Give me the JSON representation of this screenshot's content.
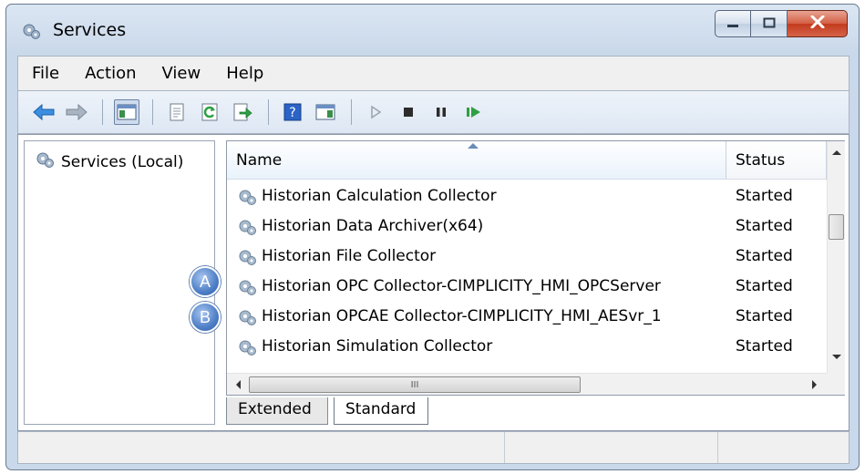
{
  "window": {
    "title": "Services"
  },
  "menu": [
    "File",
    "Action",
    "View",
    "Help"
  ],
  "toolbar_icons": [
    "back-arrow-icon",
    "forward-arrow-icon",
    "show-hide-console-tree-icon",
    "properties-icon",
    "refresh-icon",
    "export-list-icon",
    "help-icon",
    "show-action-pane-icon",
    "start-service-icon",
    "stop-service-icon",
    "pause-service-icon",
    "restart-service-icon"
  ],
  "tree": {
    "root_label": "Services (Local)"
  },
  "list": {
    "columns": {
      "name": "Name",
      "status": "Status"
    },
    "rows": [
      {
        "name": "Historian Calculation Collector",
        "status": "Started"
      },
      {
        "name": "Historian Data Archiver(x64)",
        "status": "Started"
      },
      {
        "name": "Historian File Collector",
        "status": "Started"
      },
      {
        "name": "Historian OPC Collector-CIMPLICITY_HMI_OPCServer",
        "status": "Started",
        "callout": "A"
      },
      {
        "name": "Historian OPCAE Collector-CIMPLICITY_HMI_AESvr_1",
        "status": "Started",
        "callout": "B"
      },
      {
        "name": "Historian Simulation Collector",
        "status": "Started"
      }
    ],
    "hscroll_thumb_label": "III"
  },
  "tabs": {
    "extended": "Extended",
    "standard": "Standard",
    "active": "Standard"
  },
  "callouts": {
    "a": "A",
    "b": "B"
  },
  "colors": {
    "accent": "#4e7ec6",
    "close_button": "#c33b1d",
    "toolbar_green": "#2ea043",
    "toolbar_blue": "#2b7bd6"
  }
}
